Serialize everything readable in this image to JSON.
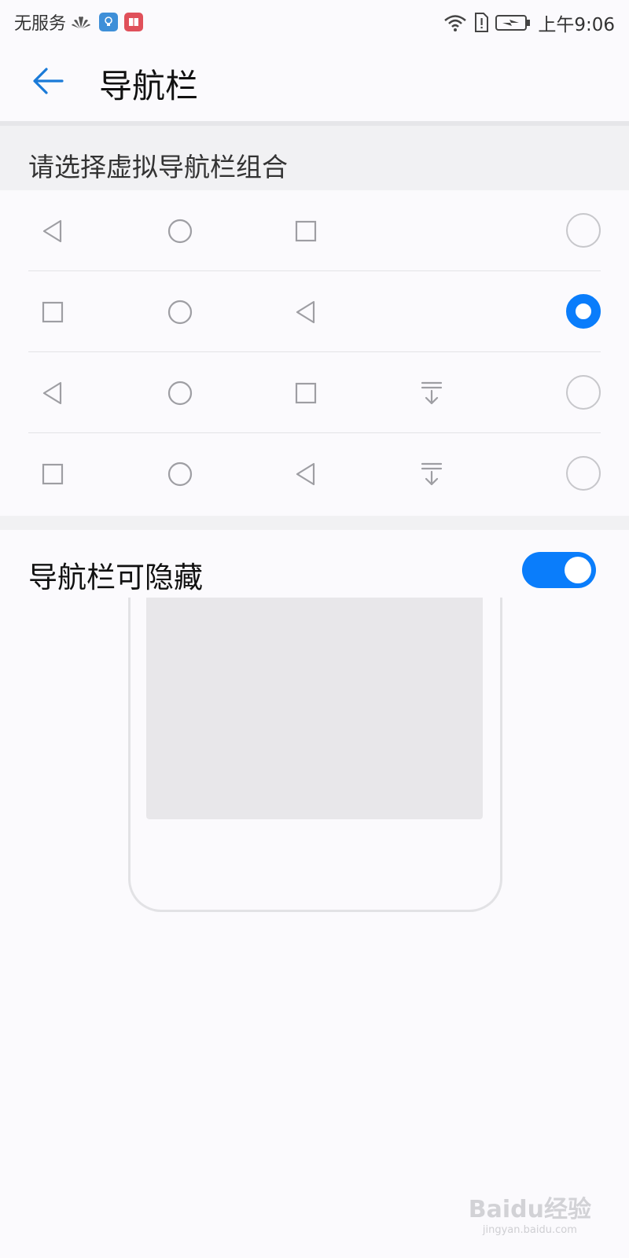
{
  "status_bar": {
    "carrier": "无服务",
    "time": "上午9:06",
    "icons": [
      "huawei-logo-icon",
      "lightbulb-app-icon",
      "book-app-icon",
      "wifi-icon",
      "sim-alert-icon",
      "battery-charging-icon"
    ]
  },
  "header": {
    "title": "导航栏",
    "back_icon": "arrow-left-icon"
  },
  "section": {
    "title": "请选择虚拟导航栏组合"
  },
  "nav_options": [
    {
      "buttons": [
        "back-triangle",
        "home-circle",
        "recent-square"
      ],
      "selected": false
    },
    {
      "buttons": [
        "recent-square",
        "home-circle",
        "back-triangle"
      ],
      "selected": true
    },
    {
      "buttons": [
        "back-triangle",
        "home-circle",
        "recent-square",
        "hide-navbar"
      ],
      "selected": false
    },
    {
      "buttons": [
        "recent-square",
        "home-circle",
        "back-triangle",
        "hide-navbar"
      ],
      "selected": false
    }
  ],
  "hide_toggle": {
    "label": "导航栏可隐藏",
    "on": true
  },
  "watermark": {
    "brand": "Baidu经验",
    "url": "jingyan.baidu.com"
  },
  "colors": {
    "accent": "#0a7dfb",
    "icon_gray": "#9e9ea3",
    "section_bg": "#f1f1f3"
  }
}
